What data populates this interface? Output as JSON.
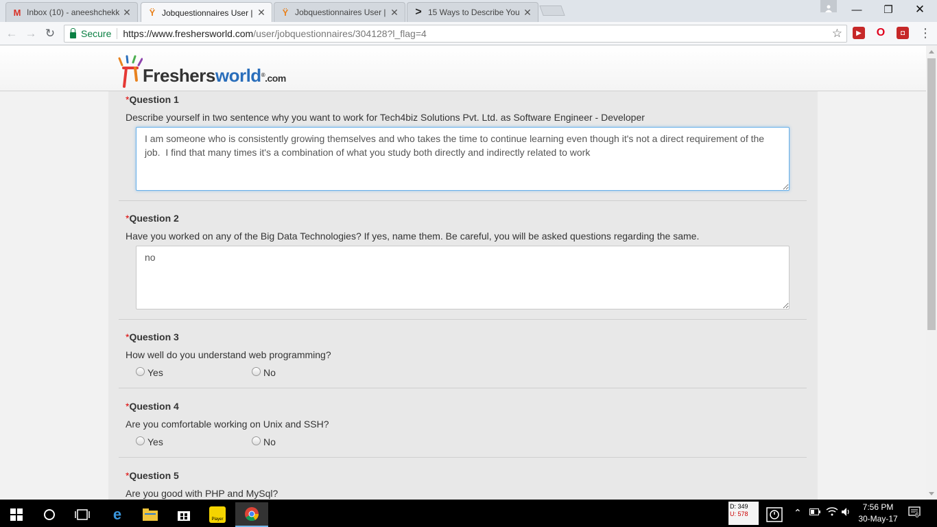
{
  "tabs": [
    {
      "title": "Inbox (10) - aneeshchekk",
      "icon": "gmail-icon"
    },
    {
      "title": "Jobquestionnaires User |",
      "icon": "freshersworld-icon",
      "active": true
    },
    {
      "title": "Jobquestionnaires User |",
      "icon": "freshersworld-icon"
    },
    {
      "title": "15 Ways to Describe You",
      "icon": "chevron-icon"
    }
  ],
  "address_bar": {
    "secure_label": "Secure",
    "url_host": "https://www.freshersworld.com",
    "url_path": "/user/jobquestionnaires/304128?l_flag=4"
  },
  "logo": {
    "brand_a": "Freshers",
    "brand_b": "world",
    "suffix": ".com",
    "registered": "®"
  },
  "questions": [
    {
      "label": "Question 1",
      "required_mark": "*",
      "text": "Describe yourself in two sentence why you want to work for Tech4biz Solutions Pvt. Ltd. as Software Engineer - Developer",
      "answer": "I am someone who is consistently growing themselves and who takes the time to continue learning even though it's not a direct requirement of the job.  I find that many times it's a combination of what you study both directly and indirectly related to work"
    },
    {
      "label": "Question 2",
      "required_mark": "*",
      "text": "Have you worked on any of the Big Data Technologies? If yes, name them. Be careful, you will be asked questions regarding the same.",
      "answer": "no"
    },
    {
      "label": "Question 3",
      "required_mark": "*",
      "text": "How well do you understand web programming?",
      "options": [
        "Yes",
        "No"
      ]
    },
    {
      "label": "Question 4",
      "required_mark": "*",
      "text": "Are you comfortable working on Unix and SSH?",
      "options": [
        "Yes",
        "No"
      ]
    },
    {
      "label": "Question 5",
      "required_mark": "*",
      "text": "Are you good with PHP and MySql?"
    }
  ],
  "taskbar": {
    "net_download": "D: 349",
    "net_upload": "U: 578",
    "time": "7:56 PM",
    "date": "30-May-17",
    "notifications": "6",
    "player_label": "Player"
  },
  "colors": {
    "required": "#dd0000",
    "brand_blue": "#2a6ebb",
    "secure_green": "#0b8043",
    "focus_border": "#66afe9"
  }
}
